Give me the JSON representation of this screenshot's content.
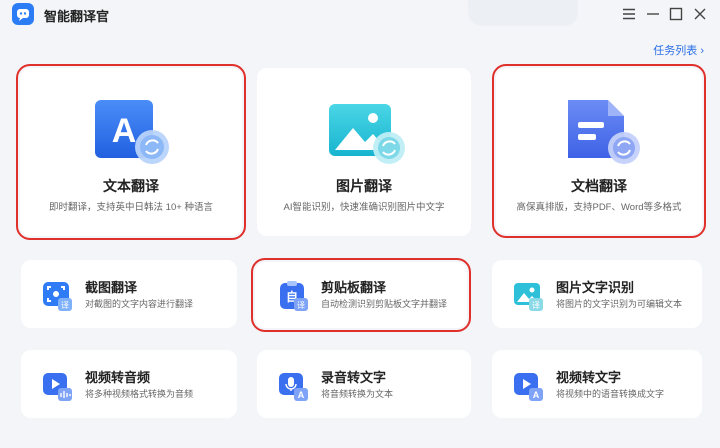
{
  "app": {
    "title": "智能翻译官"
  },
  "header": {
    "task_list": "任务列表 ›"
  },
  "big_cards": [
    {
      "title": "文本翻译",
      "subtitle": "即时翻译，支持英中日韩法 10+ 种语言",
      "icon": "text-translate-icon",
      "selected": true
    },
    {
      "title": "图片翻译",
      "subtitle": "AI智能识别，快速准确识别图片中文字",
      "icon": "image-translate-icon",
      "selected": false
    },
    {
      "title": "文档翻译",
      "subtitle": "高保真排版，支持PDF、Word等多格式",
      "icon": "document-translate-icon",
      "selected": true
    }
  ],
  "small_cards": [
    {
      "title": "截图翻译",
      "subtitle": "对截图的文字内容进行翻译",
      "icon": "screenshot-translate-icon",
      "selected": false
    },
    {
      "title": "剪贴板翻译",
      "subtitle": "自动检测识别剪贴板文字并翻译",
      "icon": "clipboard-translate-icon",
      "selected": true
    },
    {
      "title": "图片文字识别",
      "subtitle": "将图片的文字识别为可编辑文本",
      "icon": "image-ocr-icon",
      "selected": false
    },
    {
      "title": "视频转音频",
      "subtitle": "将多种视频格式转换为音频",
      "icon": "video-to-audio-icon",
      "selected": false
    },
    {
      "title": "录音转文字",
      "subtitle": "将音频转换为文本",
      "icon": "audio-to-text-icon",
      "selected": false
    },
    {
      "title": "视频转文字",
      "subtitle": "将视频中的语音转换成文字",
      "icon": "video-to-text-icon",
      "selected": false
    }
  ],
  "icon_badges": {
    "translate_badge": "译",
    "audio_badge": "A"
  },
  "colors": {
    "accent": "#2b6fe6",
    "highlight": "#e0302b",
    "card_bg": "#ffffff",
    "page_bg": "#f3f5f9"
  }
}
